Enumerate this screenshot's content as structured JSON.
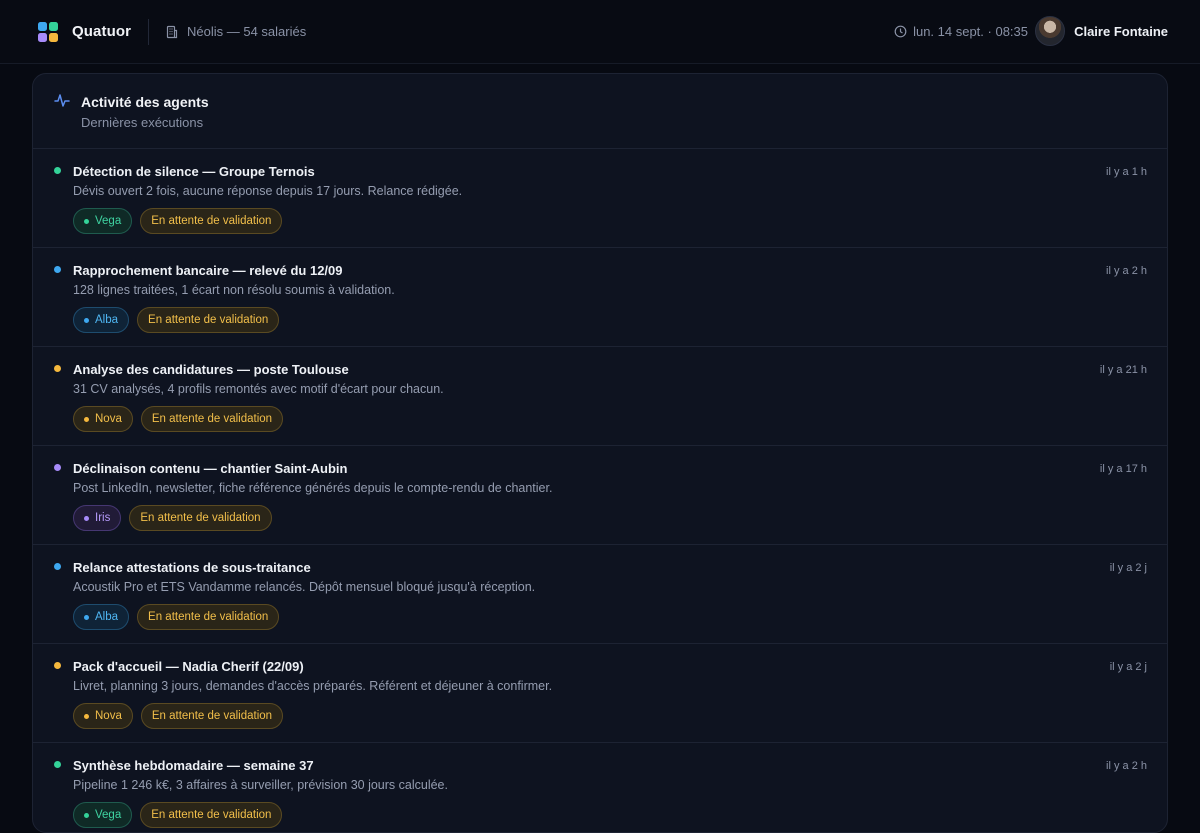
{
  "header": {
    "brand": "Quatuor",
    "company": "Néolis — 54 salariés",
    "datetime": "lun. 14 sept. · 08:35",
    "user_name": "Claire Fontaine"
  },
  "panel": {
    "title": "Activité des agents",
    "subtitle": "Dernières exécutions"
  },
  "colors": {
    "green": "#34d399",
    "blue": "#3ea8f0",
    "yellow": "#f5b83d",
    "purple": "#a78bfa"
  },
  "activities": [
    {
      "title": "Détection de silence — Groupe Ternois",
      "description": "Dévis ouvert 2 fois, aucune réponse depuis 17 jours. Relance rédigée.",
      "time": "il y a 1 h",
      "agent": "Vega",
      "color": "green",
      "status": "En attente de validation"
    },
    {
      "title": "Rapprochement bancaire — relevé du 12/09",
      "description": "128 lignes traitées, 1 écart non résolu soumis à validation.",
      "time": "il y a 2 h",
      "agent": "Alba",
      "color": "blue",
      "status": "En attente de validation"
    },
    {
      "title": "Analyse des candidatures — poste Toulouse",
      "description": "31 CV analysés, 4 profils remontés avec motif d'écart pour chacun.",
      "time": "il y a 21 h",
      "agent": "Nova",
      "color": "yellow",
      "status": "En attente de validation"
    },
    {
      "title": "Déclinaison contenu — chantier Saint-Aubin",
      "description": "Post LinkedIn, newsletter, fiche référence générés depuis le compte-rendu de chantier.",
      "time": "il y a 17 h",
      "agent": "Iris",
      "color": "purple",
      "status": "En attente de validation"
    },
    {
      "title": "Relance attestations de sous-traitance",
      "description": "Acoustik Pro et ETS Vandamme relancés. Dépôt mensuel bloqué jusqu'à réception.",
      "time": "il y a 2 j",
      "agent": "Alba",
      "color": "blue",
      "status": "En attente de validation"
    },
    {
      "title": "Pack d'accueil — Nadia Cherif (22/09)",
      "description": "Livret, planning 3 jours, demandes d'accès préparés. Référent et déjeuner à confirmer.",
      "time": "il y a 2 j",
      "agent": "Nova",
      "color": "yellow",
      "status": "En attente de validation"
    },
    {
      "title": "Synthèse hebdomadaire — semaine 37",
      "description": "Pipeline 1 246 k€, 3 affaires à surveiller, prévision 30 jours calculée.",
      "time": "il y a 2 h",
      "agent": "Vega",
      "color": "green",
      "status": "En attente de validation"
    }
  ]
}
